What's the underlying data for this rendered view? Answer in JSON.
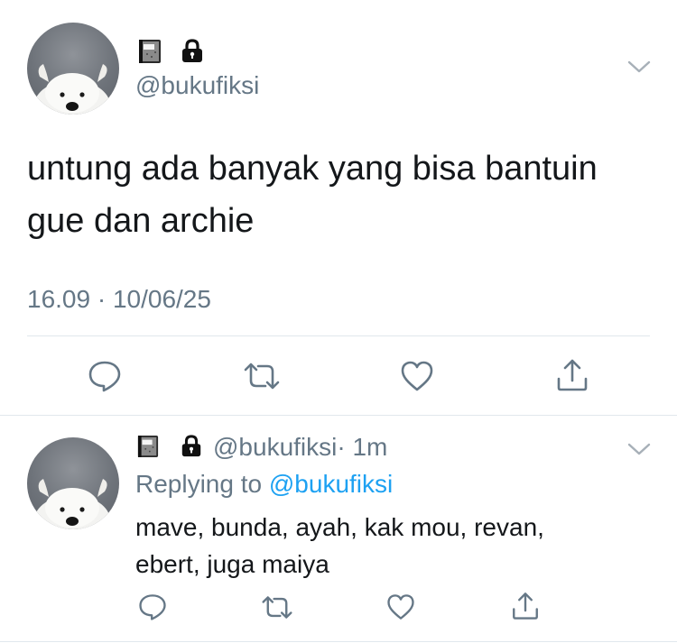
{
  "main_tweet": {
    "avatar_icon": "dog-avatar-icon",
    "badge_icons": [
      "notebook-emoji-icon",
      "lock-emoji-icon"
    ],
    "handle": "@bukufiksi",
    "text_line1": "untung ada banyak yang bisa bantuin",
    "text_line2": "gue dan archie",
    "timestamp": "16.09 · 10/06/25",
    "actions": [
      "reply-icon",
      "retweet-icon",
      "like-icon",
      "share-icon"
    ]
  },
  "reply_tweet": {
    "handle": "@bukufiksi",
    "time": "· 1m",
    "replying_label": "Replying to",
    "replying_handle": "@bukufiksi",
    "text_line1": "mave, bunda, ayah, kak mou, revan,",
    "text_line2": "ebert, juga maiya"
  },
  "colors": {
    "text": "#14171a",
    "muted": "#657786",
    "link": "#1da1f2",
    "divider": "#e1e8ed"
  }
}
